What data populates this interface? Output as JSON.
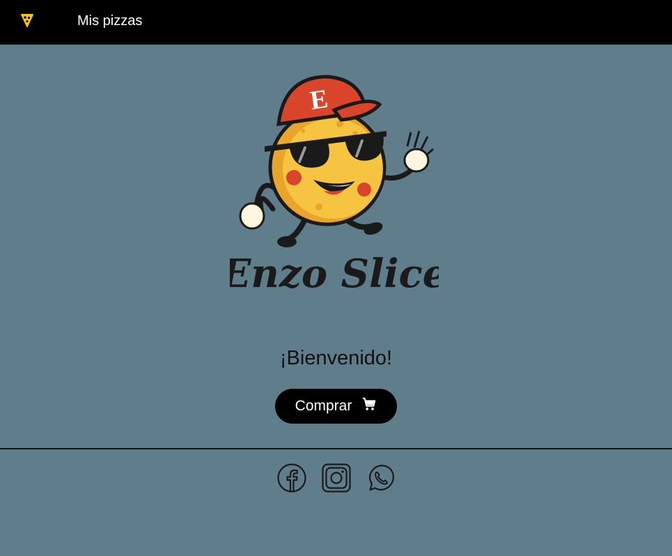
{
  "nav": {
    "brand_icon": "pizza-slice-icon",
    "link_label": "Mis pizzas"
  },
  "logo": {
    "wordmark": "Enzo Slice",
    "cap_letter": "E"
  },
  "main": {
    "welcome": "¡Bienvenido!",
    "buy_label": "Comprar",
    "buy_icon": "cart-icon"
  },
  "footer": {
    "social": [
      "facebook-icon",
      "instagram-icon",
      "whatsapp-icon"
    ]
  },
  "colors": {
    "background": "#607d8b",
    "topbar": "#000000",
    "accent": "#f9c313",
    "button": "#000000"
  }
}
